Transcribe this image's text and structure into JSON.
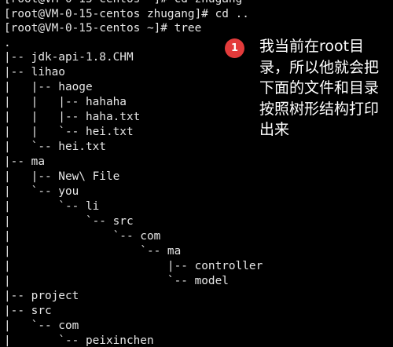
{
  "terminal": {
    "lines": [
      "[root@VM-0-15-centos ~]# cd zhugang",
      "[root@VM-0-15-centos zhugang]# cd ..",
      "[root@VM-0-15-centos ~]# tree",
      ".",
      "|-- jdk-api-1.8.CHM",
      "|-- lihao",
      "|   |-- haoge",
      "|   |   |-- hahaha",
      "|   |   |-- haha.txt",
      "|   |   `-- hei.txt",
      "|   `-- hei.txt",
      "|-- ma",
      "|   |-- New\\ File",
      "|   `-- you",
      "|       `-- li",
      "|           `-- src",
      "|               `-- com",
      "|                   `-- ma",
      "|                       |-- controller",
      "|                       `-- model",
      "|-- project",
      "|-- src",
      "|   `-- com",
      "|       `-- peixinchen"
    ]
  },
  "annotation": {
    "badge_number": "1",
    "text": "我当前在root目录，所以他就会把下面的文件和目录按照树形结构打印出来"
  },
  "colors": {
    "background": "#000000",
    "terminal_text": "#e6e6e6",
    "annotation_text": "#ffffff",
    "badge": "#e33b3b"
  }
}
